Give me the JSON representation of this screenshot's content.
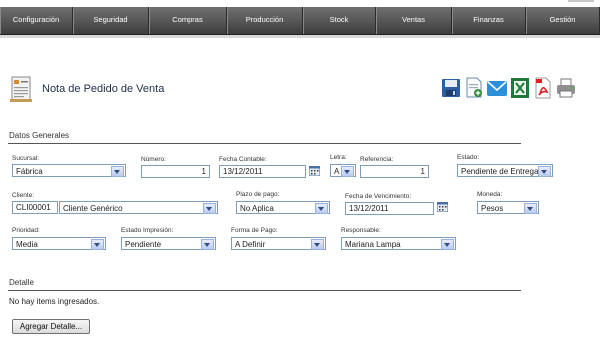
{
  "nav": {
    "items": [
      "Configuración",
      "Seguridad",
      "Compras",
      "Producción",
      "Stock",
      "Ventas",
      "Finanzas",
      "Gestión"
    ]
  },
  "page": {
    "title": "Nota de Pedido de Venta"
  },
  "toolbar": {
    "icons": [
      "save-icon",
      "new-document-icon",
      "email-icon",
      "excel-export-icon",
      "pdf-export-icon",
      "print-icon"
    ]
  },
  "sections": {
    "general": "Datos Generales",
    "detail": "Detalle"
  },
  "form": {
    "sucursal": {
      "label": "Sucursal:",
      "value": "Fábrica"
    },
    "numero": {
      "label": "Número:",
      "value": "1"
    },
    "fecha_contable": {
      "label": "Fecha Contable:",
      "value": "13/12/2011"
    },
    "letra": {
      "label": "Letra:",
      "value": "A"
    },
    "referencia": {
      "label": "Referencia:",
      "value": "1"
    },
    "estado": {
      "label": "Estado:",
      "value": "Pendiente de Entrega"
    },
    "cliente": {
      "label": "Cliente:",
      "code": "CLI00001",
      "value": "Cliente Genérico"
    },
    "plazo_pago": {
      "label": "Plazo de pago:",
      "value": "No Aplica"
    },
    "fecha_vencimiento": {
      "label": "Fecha de Vencimiento:",
      "value": "13/12/2011"
    },
    "moneda": {
      "label": "Moneda:",
      "value": "Pesos"
    },
    "prioridad": {
      "label": "Prioridad:",
      "value": "Media"
    },
    "estado_impresion": {
      "label": "Estado Impresión:",
      "value": "Pendiente"
    },
    "forma_pago": {
      "label": "Forma de Pago:",
      "value": "A Definir"
    },
    "responsable": {
      "label": "Responsable:",
      "value": "Mariana Lampa"
    }
  },
  "detail": {
    "empty_message": "No hay items ingresados.",
    "add_button": "Agregar Detalle..."
  },
  "colors": {
    "nav_bg": "#4e4e4e",
    "title_text": "#1f2f47",
    "field_border": "#7f9db9"
  }
}
